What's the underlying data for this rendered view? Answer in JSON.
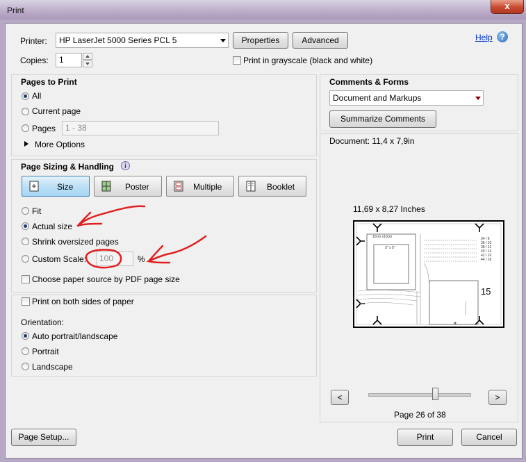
{
  "window": {
    "title": "Print",
    "close_label": "x"
  },
  "header": {
    "printer_label": "Printer:",
    "printer_value": "HP LaserJet 5000 Series PCL 5",
    "properties_label": "Properties",
    "advanced_label": "Advanced",
    "help_label": "Help",
    "copies_label": "Copies:",
    "copies_value": "1",
    "grayscale_label": "Print in grayscale (black and white)"
  },
  "pages": {
    "title": "Pages to Print",
    "all_label": "All",
    "current_label": "Current page",
    "pages_label": "Pages",
    "pages_value": "1 - 38",
    "more_options_label": "More Options"
  },
  "sizing": {
    "title": "Page Sizing & Handling",
    "tabs": [
      "Size",
      "Poster",
      "Multiple",
      "Booklet"
    ],
    "selected_tab": "Size",
    "fit_label": "Fit",
    "actual_label": "Actual size",
    "shrink_label": "Shrink oversized pages",
    "custom_label": "Custom Scale:",
    "custom_value": "100",
    "percent": "%",
    "paper_source_label": "Choose paper source by PDF page size"
  },
  "duplex": {
    "both_sides_label": "Print on both sides of paper"
  },
  "orientation": {
    "title": "Orientation:",
    "auto_label": "Auto portrait/landscape",
    "portrait_label": "Portrait",
    "landscape_label": "Landscape"
  },
  "comments": {
    "title": "Comments & Forms",
    "value": "Document and Markups",
    "summarize_label": "Summarize Comments"
  },
  "preview": {
    "document_size": "Document: 11,4 x 7,9in",
    "paper_size": "11,69 x 8,27 Inches",
    "box1": "10cm x10cm",
    "box2": "3\" x 5\"",
    "scale_lines": [
      "34 / 8",
      "36 / 10",
      "38 / 12",
      "40 / 14",
      "42 / 16",
      "44 / 18"
    ],
    "page_number": "15",
    "prev_label": "<",
    "next_label": ">",
    "page_indicator": "Page 26 of 38",
    "slider_fraction": 0.66
  },
  "footer": {
    "page_setup_label": "Page Setup...",
    "print_label": "Print",
    "cancel_label": "Cancel"
  },
  "colors": {
    "annotation": "#e02020",
    "accent_selected": "#bde0f6"
  }
}
